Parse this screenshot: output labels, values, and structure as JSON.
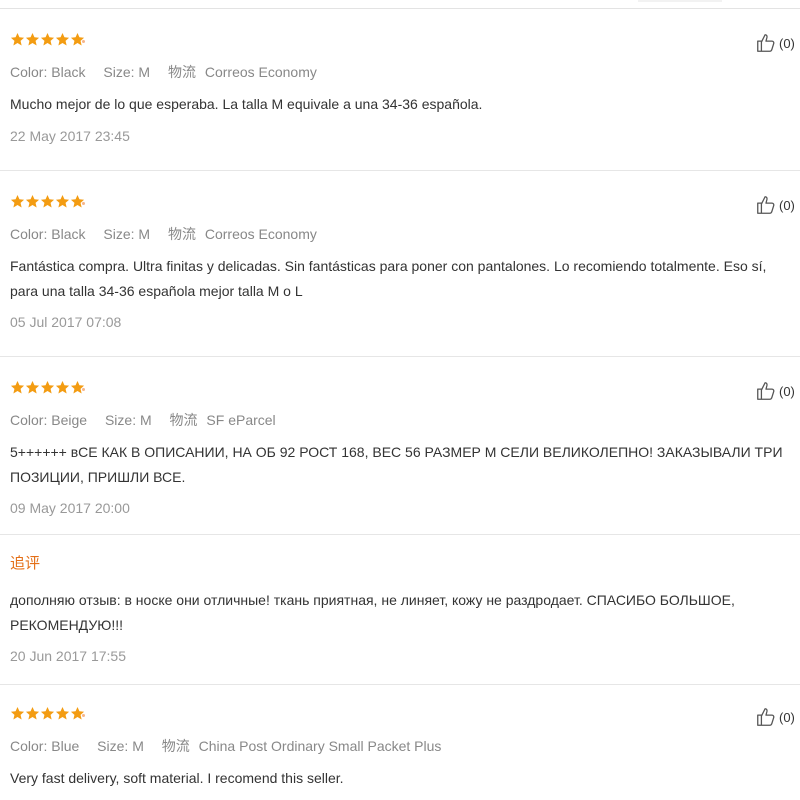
{
  "labels": {
    "color": "Color:",
    "size": "Size:",
    "logistics": "物流"
  },
  "reviews": [
    {
      "rating": 5,
      "color": "Black",
      "size": "M",
      "shipping": "Correos Economy",
      "text": "Mucho mejor de lo que esperaba. La talla M equivale a una 34-36 española.",
      "date": "22 May 2017 23:45",
      "helpful": "(0)"
    },
    {
      "rating": 5,
      "color": "Black",
      "size": "M",
      "shipping": "Correos Economy",
      "text": "Fantástica compra. Ultra finitas y delicadas. Sin fantásticas para poner con pantalones. Lo recomiendo totalmente. Eso sí, para una talla 34-36 española mejor talla M o L",
      "date": "05 Jul 2017 07:08",
      "helpful": "(0)"
    },
    {
      "rating": 5,
      "color": "Beige",
      "size": "M",
      "shipping": "SF eParcel",
      "text": "5++++++ вСЕ КАК В ОПИСАНИИ, НА ОБ 92 РОСТ 168, ВЕС 56 РАЗМЕР М СЕЛИ ВЕЛИКОЛЕПНО! ЗАКАЗЫВАЛИ ТРИ ПОЗИЦИИ, ПРИШЛИ ВСЕ.",
      "date": "09 May 2017 20:00",
      "helpful": "(0)",
      "additional": {
        "label": "追评",
        "text": "дополняю отзыв: в носке они отличные! ткань приятная, не линяет, кожу не раздродает. СПАСИБО БОЛЬШОЕ, РЕКОМЕНДУЮ!!!",
        "date": "20 Jun 2017 17:55"
      }
    },
    {
      "rating": 5,
      "color": "Blue",
      "size": "M",
      "shipping": "China Post Ordinary Small Packet Plus",
      "text": "Very fast delivery, soft material. I recomend this seller.",
      "helpful": "(0)"
    }
  ],
  "colors": {
    "star": "#f39c12",
    "additional_label": "#e46f17"
  }
}
